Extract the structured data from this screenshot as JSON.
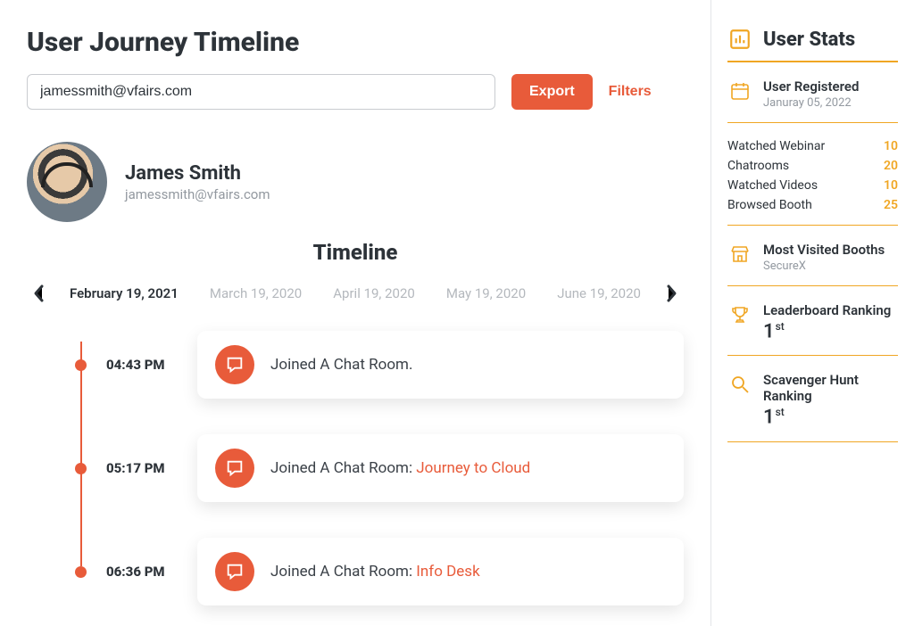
{
  "page": {
    "title": "User Journey Timeline"
  },
  "search": {
    "value": "jamessmith@vfairs.com"
  },
  "actions": {
    "export": "Export",
    "filters": "Filters"
  },
  "profile": {
    "name": "James Smith",
    "email": "jamessmith@vfairs.com"
  },
  "timeline": {
    "title": "Timeline",
    "dates": [
      {
        "label": "February 19, 2021",
        "active": true
      },
      {
        "label": "March 19, 2020",
        "active": false
      },
      {
        "label": "April  19, 2020",
        "active": false
      },
      {
        "label": "May  19, 2020",
        "active": false
      },
      {
        "label": "June 19, 2020",
        "active": false
      }
    ],
    "events": [
      {
        "time": "04:43 PM",
        "prefix": "Joined A Chat Room.",
        "highlight": ""
      },
      {
        "time": "05:17 PM",
        "prefix": "Joined A Chat Room: ",
        "highlight": "Journey to Cloud"
      },
      {
        "time": "06:36 PM",
        "prefix": "Joined A Chat Room: ",
        "highlight": "Info Desk"
      }
    ]
  },
  "stats": {
    "header": "User Stats",
    "registered": {
      "title": "User Registered",
      "date": "Januray 05, 2022"
    },
    "counts": [
      {
        "label": "Watched Webinar",
        "value": "10"
      },
      {
        "label": "Chatrooms",
        "value": "20"
      },
      {
        "label": "Watched Videos",
        "value": "10"
      },
      {
        "label": "Browsed Booth",
        "value": "25"
      }
    ],
    "mostVisited": {
      "title": "Most Visited Booths",
      "value": "SecureX"
    },
    "leaderboard": {
      "title": "Leaderboard Ranking",
      "rank": "1",
      "suffix": "st"
    },
    "scavenger": {
      "title": "Scavenger Hunt Ranking",
      "rank": "1",
      "suffix": "st"
    }
  },
  "colors": {
    "accent": "#e85b3a",
    "statsAccent": "#f0a623"
  }
}
